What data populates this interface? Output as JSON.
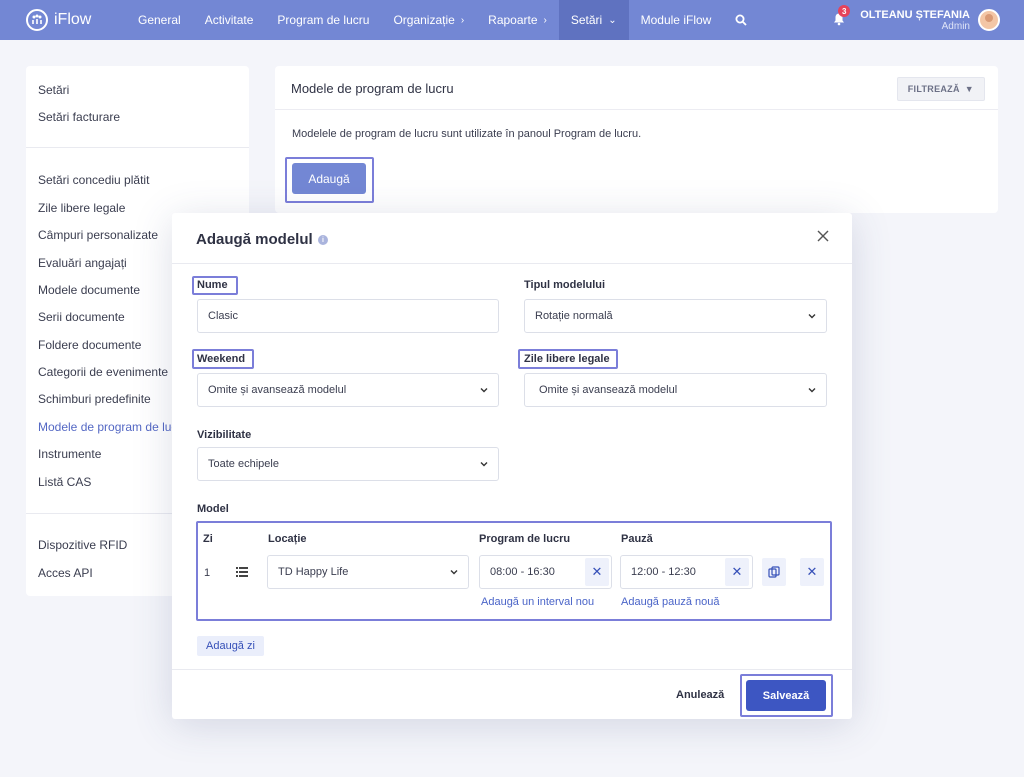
{
  "app": {
    "name": "iFlow"
  },
  "nav": {
    "items": [
      {
        "label": "General"
      },
      {
        "label": "Activitate"
      },
      {
        "label": "Program de lucru"
      },
      {
        "label": "Organizație",
        "chevron": "›"
      },
      {
        "label": "Rapoarte",
        "chevron": "›"
      },
      {
        "label": "Setări",
        "chevron": "⌄"
      },
      {
        "label": "Module iFlow"
      }
    ],
    "notifications_count": "3",
    "user_name": "OLTEANU ȘTEFANIA",
    "user_role": "Admin"
  },
  "sidebar": {
    "items": [
      {
        "label": "Setări"
      },
      {
        "label": "Setări facturare"
      },
      {
        "label": "Setări concediu plătit"
      },
      {
        "label": "Zile libere legale"
      },
      {
        "label": "Câmpuri personalizate"
      },
      {
        "label": "Evaluări angajați"
      },
      {
        "label": "Modele documente"
      },
      {
        "label": "Serii documente"
      },
      {
        "label": "Foldere documente"
      },
      {
        "label": "Categorii de evenimente"
      },
      {
        "label": "Schimburi predefinite"
      },
      {
        "label": "Modele de program de lucru"
      },
      {
        "label": "Instrumente"
      },
      {
        "label": "Listă CAS"
      },
      {
        "label": "Dispozitive RFID"
      },
      {
        "label": "Acces API"
      }
    ]
  },
  "main": {
    "title": "Modele de program de lucru",
    "filter_label": "FILTREAZĂ",
    "description": "Modelele de program de lucru sunt utilizate în panoul Program de lucru.",
    "add_label": "Adaugă"
  },
  "modal": {
    "title": "Adaugă modelul",
    "name_label": "Nume",
    "name_value": "Clasic",
    "type_label": "Tipul modelului",
    "type_value": "Rotație normală",
    "weekend_label": "Weekend",
    "weekend_value": "Omite și avansează modelul",
    "holidays_label": "Zile libere legale",
    "holidays_value": "Omite și avansează modelul",
    "visibility_label": "Vizibilitate",
    "visibility_value": "Toate echipele",
    "model_label": "Model",
    "table": {
      "headers": {
        "day": "Zi",
        "location": "Locație",
        "schedule": "Program de lucru",
        "break": "Pauză"
      },
      "row": {
        "day": "1",
        "location": "TD Happy Life",
        "schedule": "08:00 - 16:30",
        "break": "12:00 - 12:30"
      },
      "add_interval": "Adaugă un interval nou",
      "add_break": "Adaugă pauză nouă"
    },
    "add_day": "Adaugă zi",
    "cancel": "Anulează",
    "save": "Salvează"
  },
  "colors": {
    "topbar": "#7387d4",
    "accent": "#3d56c2",
    "highlight": "#7b7ed9"
  }
}
